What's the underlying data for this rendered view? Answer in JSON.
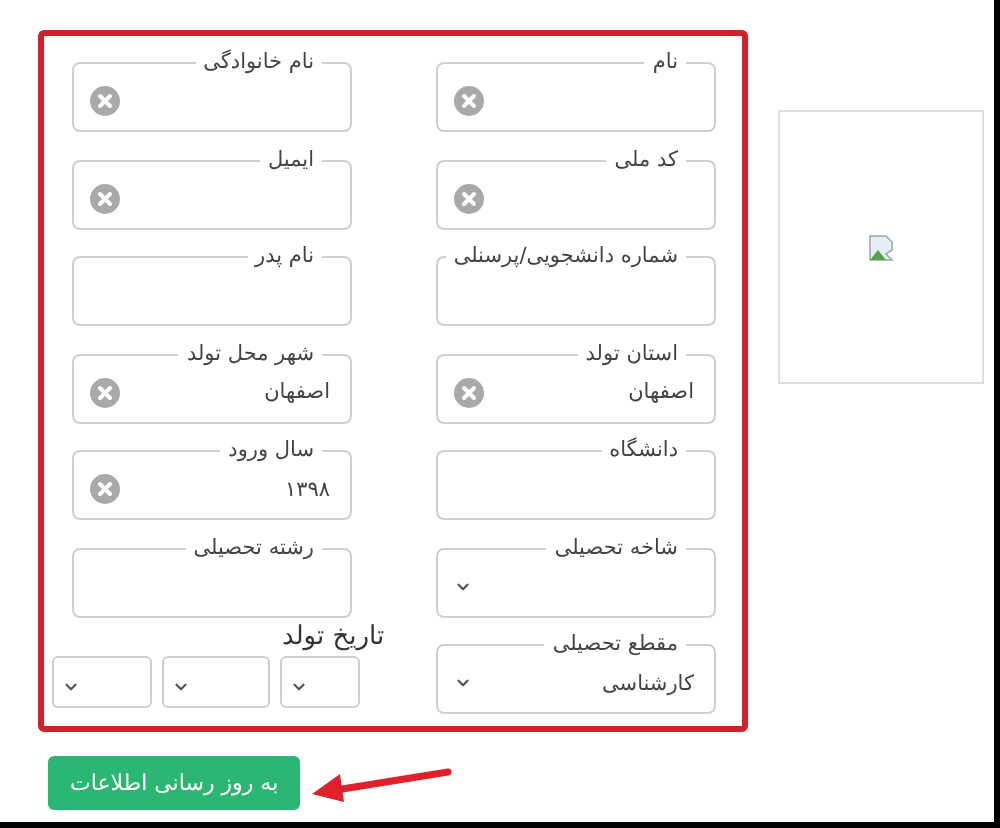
{
  "form": {
    "fields": [
      {
        "label": "نام",
        "kind": "text",
        "clearable": true
      },
      {
        "label": "نام خانوادگی",
        "kind": "text",
        "clearable": true
      },
      {
        "label": "کد ملی",
        "kind": "text",
        "clearable": true
      },
      {
        "label": "ایمیل",
        "kind": "text",
        "clearable": true
      },
      {
        "label": "شماره دانشجویی/پرسنلی",
        "kind": "text",
        "clearable": false
      },
      {
        "label": "نام پدر",
        "kind": "text",
        "clearable": false
      },
      {
        "label": "استان تولد",
        "kind": "text",
        "clearable": true,
        "value": "اصفهان"
      },
      {
        "label": "شهر محل تولد",
        "kind": "text",
        "clearable": true,
        "value": "اصفهان"
      },
      {
        "label": "دانشگاه",
        "kind": "text",
        "clearable": false
      },
      {
        "label": "سال ورود",
        "kind": "text",
        "clearable": true,
        "value": "۱۳۹۸"
      },
      {
        "label": "شاخه تحصیلی",
        "kind": "select"
      },
      {
        "label": "رشته تحصیلی",
        "kind": "text",
        "clearable": false
      },
      {
        "label": "مقطع تحصیلی",
        "kind": "select",
        "value": "کارشناسی"
      },
      {
        "label": "تاریخ تولد",
        "kind": "date",
        "parts": [
          {
            "kind": "select"
          },
          {
            "kind": "select"
          },
          {
            "kind": "select"
          }
        ]
      }
    ]
  },
  "profile_image": {
    "kind": "broken"
  },
  "submit_button": {
    "label": "به روز رسانی اطلاعات"
  },
  "annotation": {
    "kind": "arrow"
  }
}
